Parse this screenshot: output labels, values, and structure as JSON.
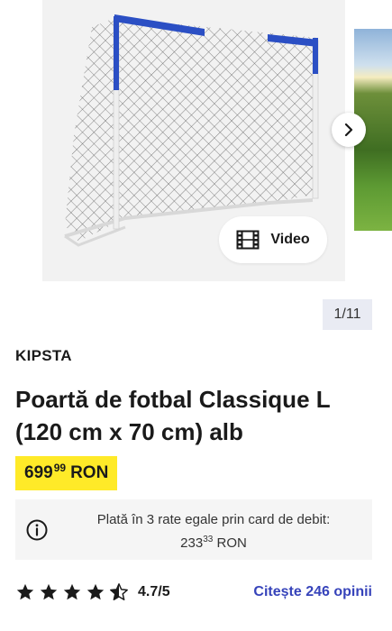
{
  "gallery": {
    "video_label": "Video",
    "counter": "1/11"
  },
  "product": {
    "brand": "KIPSTA",
    "title": "Poartă de fotbal Classique L (120 cm x 70 cm) alb",
    "price_int": "699",
    "price_dec": "99",
    "currency": "RON",
    "installment_line1": "Plată în 3 rate egale prin card de debit:",
    "installment_int": "233",
    "installment_dec": "33",
    "installment_currency": "RON",
    "rating_value": "4.7/5",
    "rating_stars": 4.7,
    "reviews_link": "Citește 246 opinii"
  },
  "colors": {
    "price_highlight": "#ffea28",
    "link": "#3643ba",
    "goal_frame_blue": "#2b4fc4"
  }
}
